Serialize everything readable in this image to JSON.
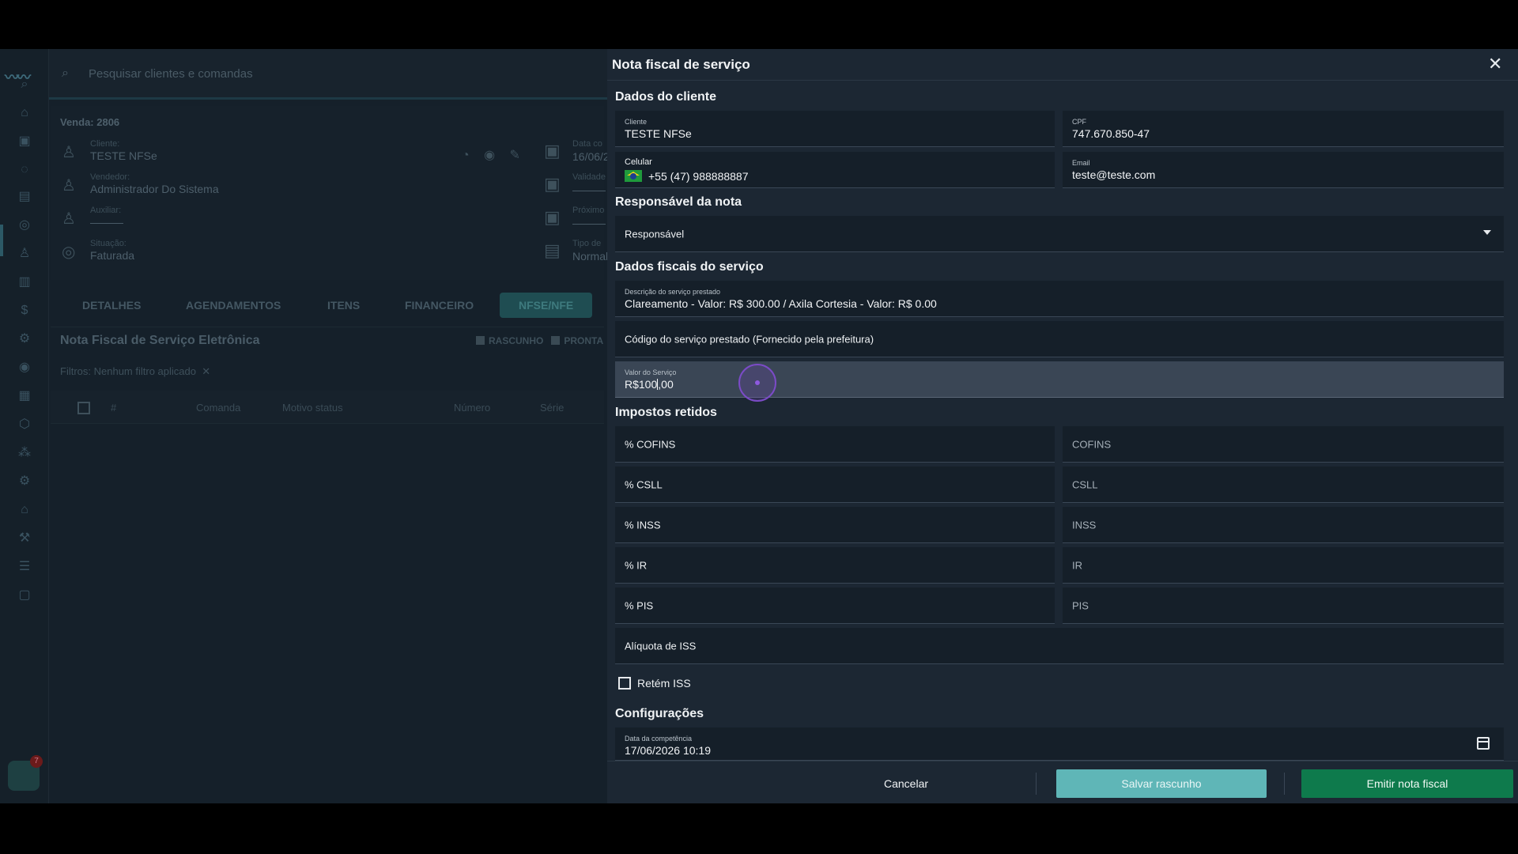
{
  "background": {
    "search_placeholder": "Pesquisar clientes e comandas",
    "sale_title": "Venda: 2806",
    "client_label": "Cliente:",
    "client_value": "TESTE NFSe",
    "seller_label": "Vendedor:",
    "seller_value": "Administrador Do Sistema",
    "helper_label": "Auxiliar:",
    "helper_value": "———",
    "status_label": "Situação:",
    "status_value": "Faturada",
    "date_label": "Data co",
    "date_value": "16/06/2",
    "validity_label": "Validade",
    "validity_value": "———",
    "next_label": "Próximo",
    "next_value": "———",
    "type_label": "Tipo de",
    "type_value": "Normal",
    "tabs": [
      "DETALHES",
      "AGENDAMENTOS",
      "ITENS",
      "FINANCEIRO",
      "NFSE/NFE"
    ],
    "nfse_title": "Nota Fiscal de Serviço Eletrônica",
    "legend_draft": "RASCUNHO",
    "legend_ready": "PRONTA",
    "filters_label": "Filtros:",
    "filters_value": "Nenhum filtro aplicado",
    "table_headers": [
      "#",
      "Comanda",
      "Motivo status",
      "Número",
      "Série"
    ],
    "chat_badge": "7"
  },
  "modal": {
    "title": "Nota fiscal de serviço",
    "sections": {
      "client": "Dados do cliente",
      "responsible": "Responsável da nota",
      "fiscal": "Dados fiscais do serviço",
      "taxes": "Impostos retidos",
      "config": "Configurações"
    },
    "client": {
      "name_label": "Cliente",
      "name_value": "TESTE NFSe",
      "cpf_label": "CPF",
      "cpf_value": "747.670.850-47",
      "phone_label": "Celular",
      "phone_value": "+55 (47) 988888887",
      "email_label": "Email",
      "email_value": "teste@teste.com"
    },
    "responsible_placeholder": "Responsável",
    "fiscal": {
      "description_label": "Descrição do serviço prestado",
      "description_value": "Clareamento - Valor: R$ 300.00 / Axila Cortesia - Valor: R$ 0.00",
      "code_placeholder": "Código do serviço prestado (Fornecido pela prefeitura)",
      "service_value_label": "Valor do Serviço",
      "service_value_before_caret": "R$100",
      "service_value_after_caret": ",00"
    },
    "taxes": {
      "cofins_pct": "% COFINS",
      "cofins": "COFINS",
      "csll_pct": "% CSLL",
      "csll": "CSLL",
      "inss_pct": "% INSS",
      "inss": "INSS",
      "ir_pct": "% IR",
      "ir": "IR",
      "pis_pct": "% PIS",
      "pis": "PIS",
      "iss_rate": "Alíquota de ISS",
      "retain_iss": "Retém ISS"
    },
    "config": {
      "competence_label": "Data da competência",
      "competence_value": "17/06/2026 10:19"
    },
    "buttons": {
      "cancel": "Cancelar",
      "save_draft": "Salvar rascunho",
      "emit": "Emitir nota fiscal"
    }
  }
}
